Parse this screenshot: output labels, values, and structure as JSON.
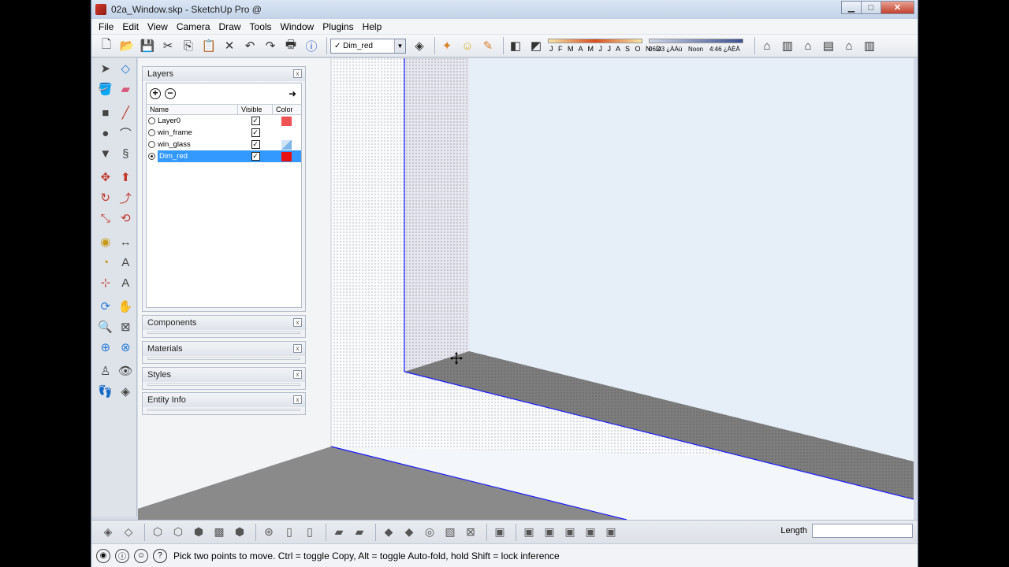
{
  "window": {
    "title": "02a_Window.skp - SketchUp Pro @"
  },
  "menu": [
    "File",
    "Edit",
    "View",
    "Camera",
    "Draw",
    "Tools",
    "Window",
    "Plugins",
    "Help"
  ],
  "toolbar": {
    "layer_select": "Dim_red",
    "shadow_months": "J F M A M J J A S O N D",
    "shadow_time1": "06:43 ¿ÀÀü",
    "shadow_noon": "Noon",
    "shadow_time2": "4:46 ¿ÀÈÄ"
  },
  "layers_panel": {
    "title": "Layers",
    "columns": {
      "name": "Name",
      "visible": "Visible",
      "color": "Color"
    },
    "rows": [
      {
        "name": "Layer0",
        "visible": "✓",
        "color": "#ef5252",
        "active": false
      },
      {
        "name": "win_frame",
        "visible": "✓",
        "color": "",
        "active": false
      },
      {
        "name": "win_glass",
        "visible": "✓",
        "color": "#7db7ea",
        "active": false
      },
      {
        "name": "Dim_red",
        "visible": "✓",
        "color": "#e81111",
        "active": true
      }
    ]
  },
  "trays": [
    {
      "title": "Components"
    },
    {
      "title": "Materials"
    },
    {
      "title": "Styles"
    },
    {
      "title": "Entity Info"
    }
  ],
  "measurements": {
    "label": "Length",
    "value": ""
  },
  "status": {
    "text": "Pick two points to move.  Ctrl = toggle Copy, Alt = toggle Auto-fold, hold Shift = lock inference"
  },
  "colors": {
    "model_edge": "#1a1aff",
    "face_dark": "#7d7d7d",
    "glass": "#e6eef8"
  }
}
